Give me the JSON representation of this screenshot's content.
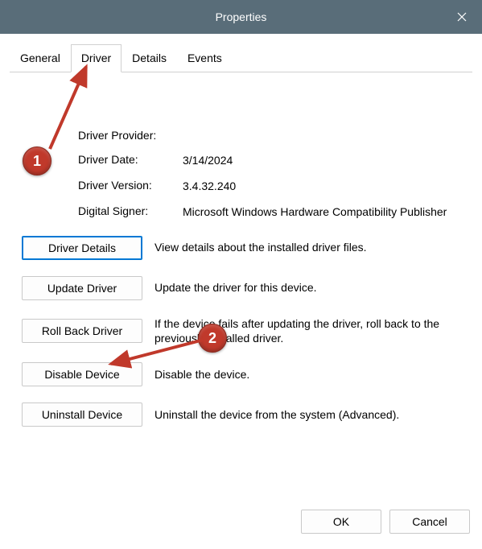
{
  "window": {
    "title": "Properties"
  },
  "tabs": {
    "general": "General",
    "driver": "Driver",
    "details": "Details",
    "events": "Events",
    "active": "driver"
  },
  "info": {
    "provider_label": "Driver Provider:",
    "provider_value": "",
    "date_label": "Driver Date:",
    "date_value": "3/14/2024",
    "version_label": "Driver Version:",
    "version_value": "3.4.32.240",
    "signer_label": "Digital Signer:",
    "signer_value": "Microsoft Windows Hardware Compatibility Publisher"
  },
  "actions": {
    "details": {
      "label": "Driver Details",
      "desc": "View details about the installed driver files."
    },
    "update": {
      "label": "Update Driver",
      "desc": "Update the driver for this device."
    },
    "rollback": {
      "label": "Roll Back Driver",
      "desc": "If the device fails after updating the driver, roll back to the previously installed driver."
    },
    "disable": {
      "label": "Disable Device",
      "desc": "Disable the device."
    },
    "uninstall": {
      "label": "Uninstall Device",
      "desc": "Uninstall the device from the system (Advanced)."
    }
  },
  "footer": {
    "ok": "OK",
    "cancel": "Cancel"
  },
  "annotations": {
    "badge1": "1",
    "badge2": "2"
  }
}
